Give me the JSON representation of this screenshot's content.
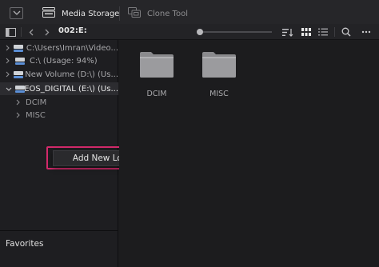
{
  "tabs": {
    "media_storage": "Media Storage",
    "clone_tool": "Clone Tool"
  },
  "toolbar": {
    "path": "002:E:"
  },
  "tree": {
    "drives": [
      {
        "label": "C:\\Users\\Imran\\Video...",
        "expanded": false,
        "selected": false
      },
      {
        "label": "C:\\ (Usage: 94%)",
        "expanded": false,
        "selected": false
      },
      {
        "label": "New Volume (D:\\) (Us...",
        "expanded": false,
        "selected": false
      },
      {
        "label": "EOS_DIGITAL (E:\\) (Us...",
        "expanded": true,
        "selected": true
      }
    ],
    "subfolders": [
      "DCIM",
      "MISC"
    ]
  },
  "context_menu": {
    "item": "Add New Location"
  },
  "favorites": {
    "label": "Favorites"
  },
  "folders": [
    {
      "name": "DCIM"
    },
    {
      "name": "MISC"
    }
  ],
  "icons": [
    "menu-icon",
    "media-storage-icon",
    "clone-tool-icon",
    "panel-toggle-icon",
    "back-icon",
    "forward-icon",
    "sort-icon",
    "grid-view-icon",
    "list-view-icon",
    "search-icon",
    "more-icon",
    "drive-icon",
    "folder-icon",
    "chevron-right-icon",
    "chevron-down-icon"
  ],
  "colors": {
    "accent_highlight": "#d42a6c",
    "drive_blue": "#5b8fd6",
    "background": "#1c1c1e"
  }
}
